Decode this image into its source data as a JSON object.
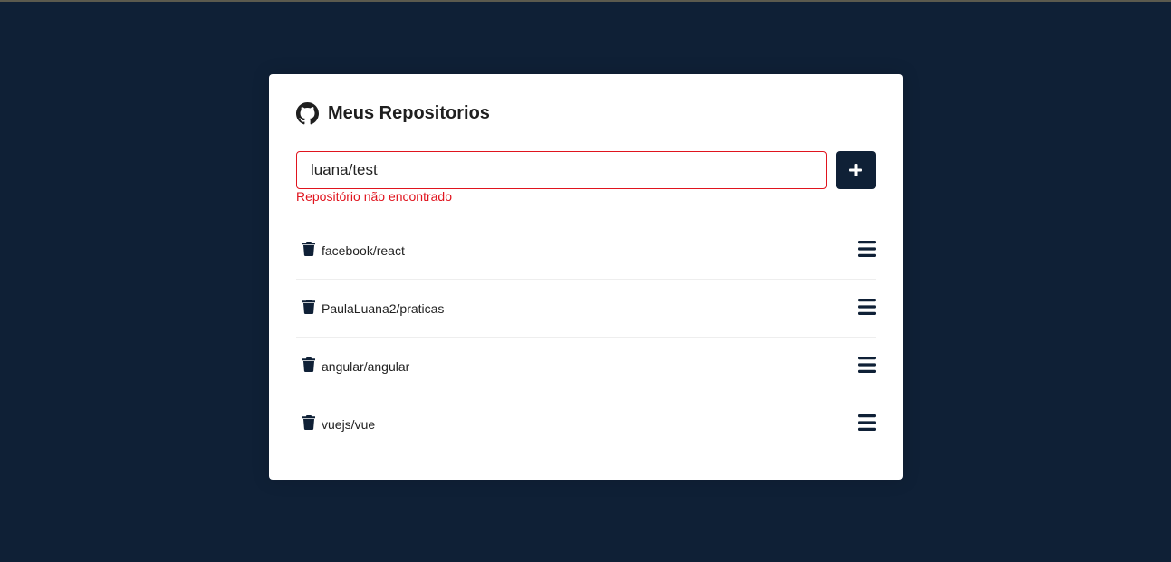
{
  "header": {
    "title": "Meus Repositorios",
    "icon": "github-icon"
  },
  "form": {
    "input_value": "luana/test",
    "add_button_icon": "plus-icon",
    "error_message": "Repositório não encontrado"
  },
  "repositories": [
    {
      "name": "facebook/react"
    },
    {
      "name": "PaulaLuana2/praticas"
    },
    {
      "name": "angular/angular"
    },
    {
      "name": "vuejs/vue"
    }
  ],
  "icons": {
    "delete": "trash-icon",
    "details": "bars-icon"
  },
  "colors": {
    "background": "#0f2036",
    "card": "#ffffff",
    "error": "#e0141e",
    "button": "#0f2036"
  }
}
